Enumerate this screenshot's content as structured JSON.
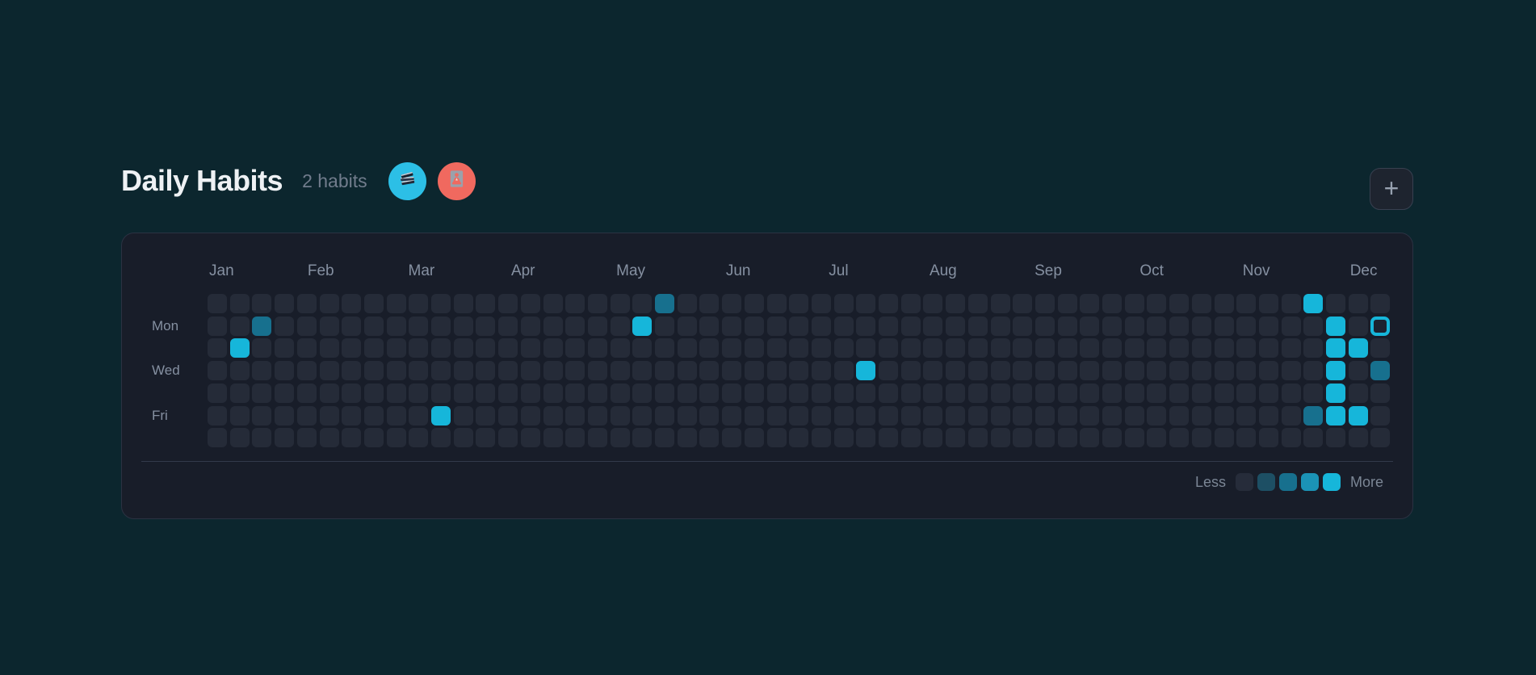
{
  "header": {
    "title": "Daily Habits",
    "habit_count_label": "2 habits",
    "add_button_label": "+",
    "habits": [
      {
        "name": "reading",
        "icon": "books-icon",
        "avatar_color": "#2cbfe6"
      },
      {
        "name": "meditation",
        "icon": "meditation-icon",
        "avatar_color": "#f0695f"
      }
    ]
  },
  "heatmap": {
    "months": [
      {
        "label": "Jan",
        "start_col": 0.0
      },
      {
        "label": "Feb",
        "start_col": 4.4
      },
      {
        "label": "Mar",
        "start_col": 8.9
      },
      {
        "label": "Apr",
        "start_col": 13.5
      },
      {
        "label": "May",
        "start_col": 18.2
      },
      {
        "label": "Jun",
        "start_col": 23.1
      },
      {
        "label": "Jul",
        "start_col": 27.7
      },
      {
        "label": "Aug",
        "start_col": 32.2
      },
      {
        "label": "Sep",
        "start_col": 36.9
      },
      {
        "label": "Oct",
        "start_col": 41.6
      },
      {
        "label": "Nov",
        "start_col": 46.2
      },
      {
        "label": "Dec",
        "start_col": 51.0
      }
    ],
    "day_labels": [
      {
        "label": "Mon",
        "row": 1
      },
      {
        "label": "Wed",
        "row": 3
      },
      {
        "label": "Fri",
        "row": 5
      }
    ],
    "cols": 53,
    "rows": 7,
    "active_cells": [
      {
        "col": 1,
        "row": 2,
        "level": 4
      },
      {
        "col": 2,
        "row": 1,
        "level": 2
      },
      {
        "col": 10,
        "row": 5,
        "level": 4
      },
      {
        "col": 19,
        "row": 1,
        "level": 4
      },
      {
        "col": 20,
        "row": 0,
        "level": 2
      },
      {
        "col": 29,
        "row": 3,
        "level": 4
      },
      {
        "col": 49,
        "row": 0,
        "level": 4
      },
      {
        "col": 49,
        "row": 5,
        "level": 2
      },
      {
        "col": 50,
        "row": 1,
        "level": 4
      },
      {
        "col": 50,
        "row": 2,
        "level": 4
      },
      {
        "col": 50,
        "row": 3,
        "level": 4
      },
      {
        "col": 50,
        "row": 4,
        "level": 4
      },
      {
        "col": 50,
        "row": 5,
        "level": 4
      },
      {
        "col": 51,
        "row": 2,
        "level": 4
      },
      {
        "col": 51,
        "row": 5,
        "level": 4
      },
      {
        "col": 52,
        "row": 3,
        "level": 2
      }
    ],
    "today_cell": {
      "col": 52,
      "row": 1
    },
    "colors": {
      "empty": "#252b38",
      "level1": "#1d4f64",
      "level2": "#17708e",
      "level3": "#1b93b6",
      "level4": "#16b6da",
      "today_ring": "#16b6da"
    }
  },
  "legend": {
    "less_label": "Less",
    "more_label": "More",
    "levels": [
      "#262c3a",
      "#1d4f64",
      "#17708e",
      "#1b93b6",
      "#16b6da"
    ]
  }
}
